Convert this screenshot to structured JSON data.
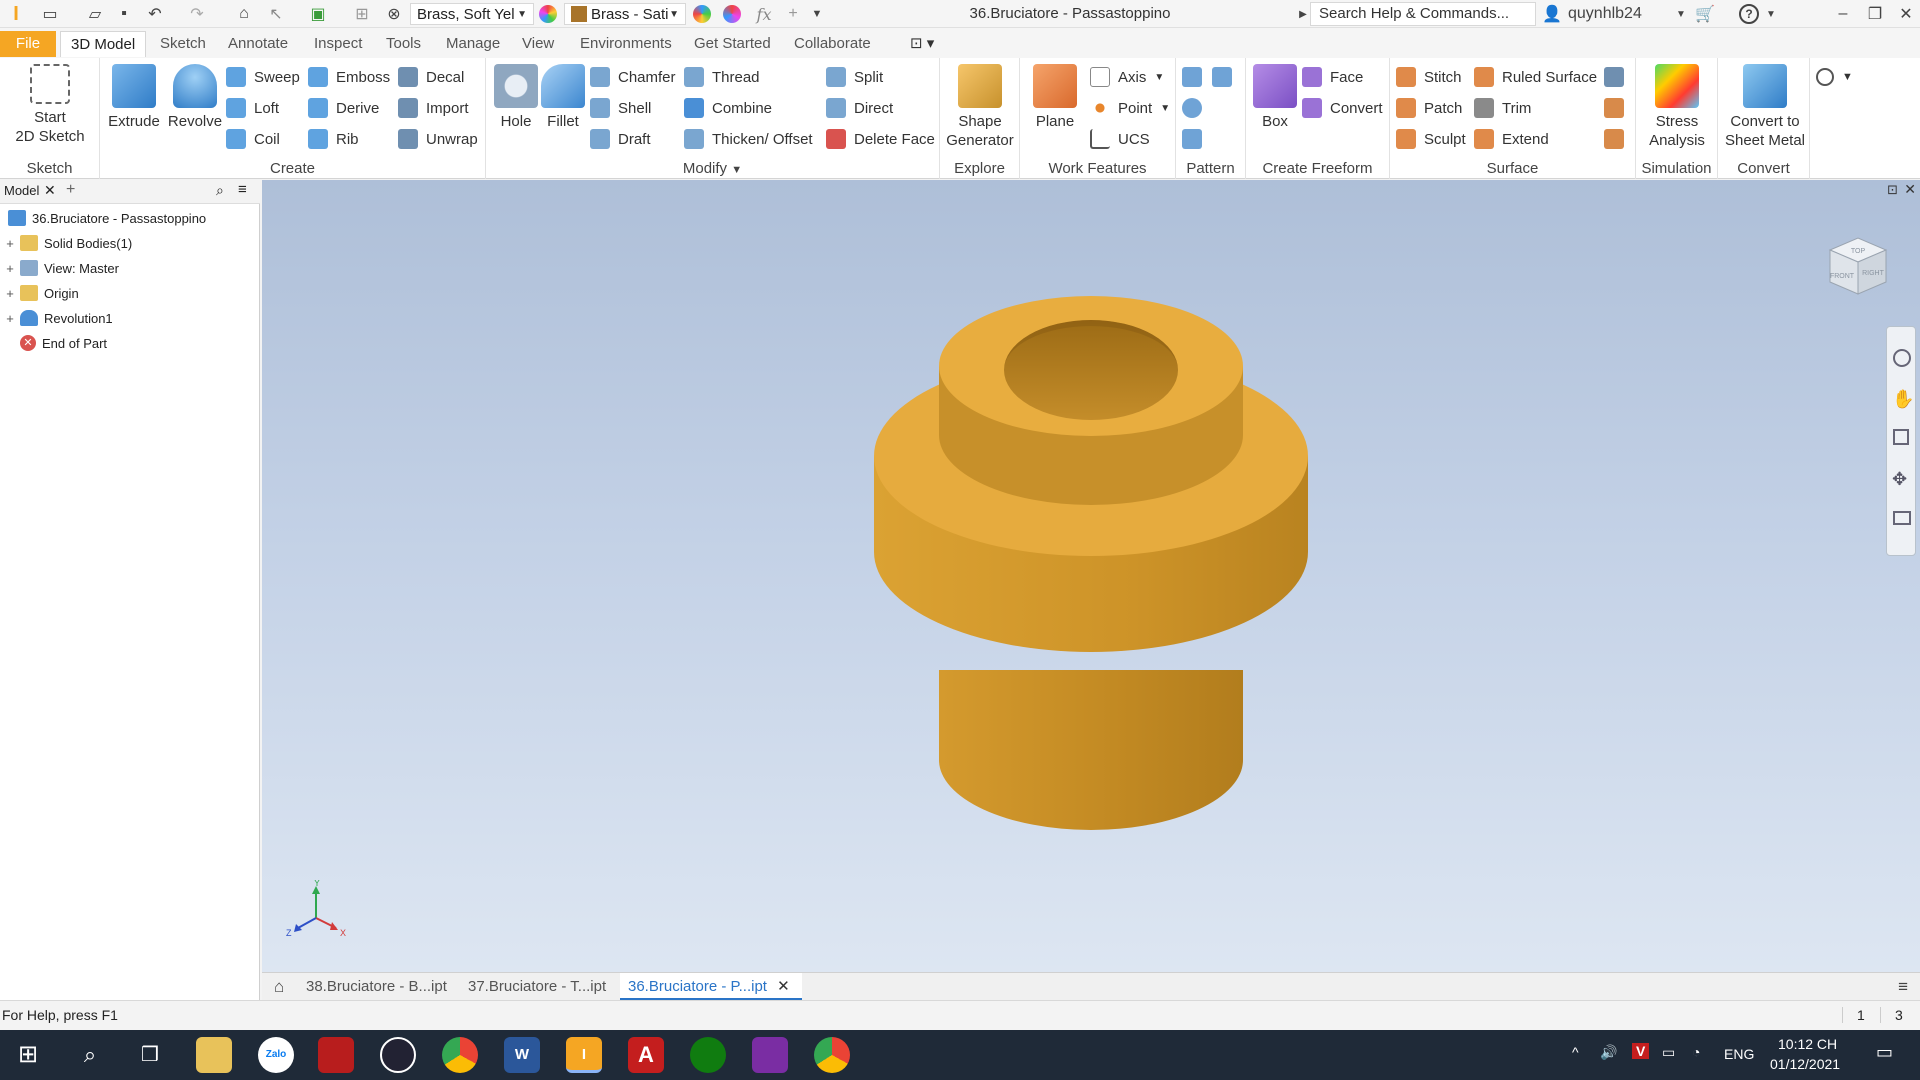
{
  "titlebar": {
    "material": "Brass, Soft Yel",
    "appearance": "Brass - Sati",
    "doc_title": "36.Bruciatore - Passastoppino",
    "search_placeholder": "Search Help & Commands...",
    "user": "quynhlb24"
  },
  "tabs": {
    "file": "File",
    "items": [
      "3D Model",
      "Sketch",
      "Annotate",
      "Inspect",
      "Tools",
      "Manage",
      "View",
      "Environments",
      "Get Started",
      "Collaborate"
    ]
  },
  "ribbon": {
    "sketch": {
      "label": "Sketch",
      "start": "Start",
      "start2": "2D Sketch"
    },
    "create": {
      "label": "Create",
      "extrude": "Extrude",
      "revolve": "Revolve",
      "sweep": "Sweep",
      "loft": "Loft",
      "coil": "Coil",
      "emboss": "Emboss",
      "derive": "Derive",
      "rib": "Rib",
      "decal": "Decal",
      "import": "Import",
      "unwrap": "Unwrap"
    },
    "modify": {
      "label": "Modify",
      "hole": "Hole",
      "fillet": "Fillet",
      "chamfer": "Chamfer",
      "shell": "Shell",
      "draft": "Draft",
      "thread": "Thread",
      "combine": "Combine",
      "thicken": "Thicken/ Offset",
      "split": "Split",
      "direct": "Direct",
      "delete_face": "Delete Face"
    },
    "explore": {
      "label": "Explore",
      "shape1": "Shape",
      "shape2": "Generator"
    },
    "work": {
      "label": "Work Features",
      "plane": "Plane",
      "axis": "Axis",
      "point": "Point",
      "ucs": "UCS"
    },
    "pattern": {
      "label": "Pattern"
    },
    "freeform": {
      "label": "Create Freeform",
      "box": "Box",
      "face": "Face",
      "convert": "Convert"
    },
    "surface": {
      "label": "Surface",
      "stitch": "Stitch",
      "patch": "Patch",
      "sculpt": "Sculpt",
      "ruled": "Ruled Surface",
      "trim": "Trim",
      "extend": "Extend"
    },
    "simulation": {
      "label": "Simulation",
      "stress1": "Stress",
      "stress2": "Analysis"
    },
    "convert": {
      "label": "Convert",
      "c1": "Convert to",
      "c2": "Sheet Metal"
    }
  },
  "browser": {
    "tab": "Model",
    "items": [
      {
        "label": "36.Bruciatore - Passastoppino"
      },
      {
        "label": "Solid Bodies(1)"
      },
      {
        "label": "View: Master"
      },
      {
        "label": "Origin"
      },
      {
        "label": "Revolution1"
      },
      {
        "label": "End of Part"
      }
    ]
  },
  "viewcube": {
    "front": "FRONT",
    "right": "RIGHT",
    "top": "TOP"
  },
  "triad": {
    "x": "X",
    "y": "Y",
    "z": "Z"
  },
  "doctabs": [
    "38.Bruciatore - B...ipt",
    "37.Bruciatore - T...ipt",
    "36.Bruciatore - P...ipt"
  ],
  "status": {
    "help": "For Help, press F1",
    "n1": "1",
    "n2": "3"
  },
  "taskbar": {
    "lang": "ENG",
    "time": "10:12 CH",
    "date": "01/12/2021",
    "zalo": "Zalo"
  },
  "colors": {
    "accent": "#f5a623",
    "part": "#e8ad3f",
    "part_dark": "#c98f24",
    "link": "#2a74c7"
  }
}
